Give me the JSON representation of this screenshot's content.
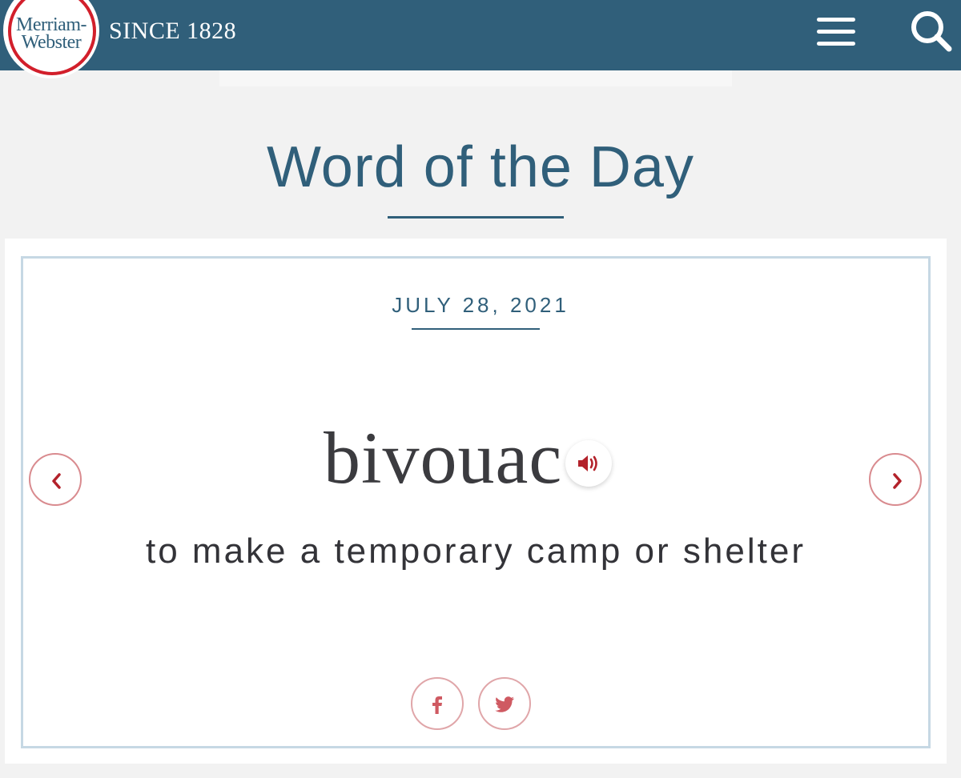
{
  "header": {
    "logo_line1": "Merriam-",
    "logo_line2": "Webster",
    "tagline": "SINCE 1828",
    "menu_icon": "hamburger-menu-icon",
    "search_icon": "search-icon",
    "bar_color": "#305f7a",
    "logo_ring_color": "#d21f2b"
  },
  "page": {
    "heading": "Word of the Day"
  },
  "wotd": {
    "date": "JULY 28, 2021",
    "word": "bivouac",
    "definition": "to make a temporary camp or shelter",
    "audio_icon": "speaker-icon",
    "prev_icon": "chevron-left-icon",
    "next_icon": "chevron-right-icon",
    "accent_color": "#b3222b"
  },
  "share": {
    "facebook_icon": "facebook-icon",
    "twitter_icon": "twitter-icon"
  }
}
